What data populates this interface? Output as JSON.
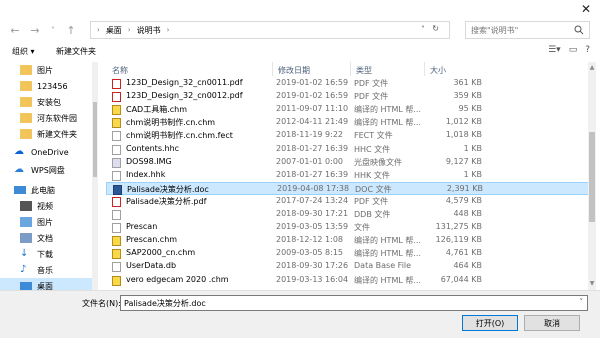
{
  "titlebar": {
    "close_glyph": "✕"
  },
  "address": {
    "segments": [
      "桌面",
      "说明书"
    ],
    "separator": "›",
    "drop_glyph": "˅",
    "refresh_glyph": "↻"
  },
  "search": {
    "placeholder": "搜索\"说明书\""
  },
  "toolbar": {
    "organize": "组织 ▾",
    "new_folder": "新建文件夹"
  },
  "nav": {
    "items": [
      {
        "label": "图片",
        "icon": "folder-icon"
      },
      {
        "label": "123456",
        "icon": "folder-icon"
      },
      {
        "label": "安装包",
        "icon": "folder-icon"
      },
      {
        "label": "河东软件园",
        "icon": "folder-icon"
      },
      {
        "label": "新建文件夹",
        "icon": "folder-icon"
      },
      {
        "label": "OneDrive",
        "icon": "cloud-icon"
      },
      {
        "label": "WPS网盘",
        "icon": "cloud-icon"
      },
      {
        "label": "此电脑",
        "icon": "computer-icon"
      },
      {
        "label": "视频",
        "icon": "video-icon"
      },
      {
        "label": "图片",
        "icon": "picture-icon"
      },
      {
        "label": "文档",
        "icon": "document-icon"
      },
      {
        "label": "下载",
        "icon": "download-icon"
      },
      {
        "label": "音乐",
        "icon": "music-icon"
      },
      {
        "label": "桌面",
        "icon": "desktop-icon"
      }
    ]
  },
  "columns": {
    "name": "名称",
    "date": "修改日期",
    "type": "类型",
    "size": "大小"
  },
  "files": [
    {
      "name": "123D_Design_32_cn0011.pdf",
      "date": "2019-01-02 16:59",
      "type": "PDF 文件",
      "size": "361 KB",
      "kind": "pdf"
    },
    {
      "name": "123D_Design_32_cn0012.pdf",
      "date": "2019-01-02 16:59",
      "type": "PDF 文件",
      "size": "359 KB",
      "kind": "pdf"
    },
    {
      "name": "CAD工具箱.chm",
      "date": "2011-09-07 11:10",
      "type": "编译的 HTML 帮...",
      "size": "95 KB",
      "kind": "chm"
    },
    {
      "name": "chm说明书制作.cn.chm",
      "date": "2012-04-11 21:49",
      "type": "编译的 HTML 帮...",
      "size": "1,012 KB",
      "kind": "chm"
    },
    {
      "name": "chm说明书制作.cn.chm.fect",
      "date": "2018-11-19 9:22",
      "type": "FECT 文件",
      "size": "1,018 KB",
      "kind": "blank"
    },
    {
      "name": "Contents.hhc",
      "date": "2018-01-27 16:39",
      "type": "HHC 文件",
      "size": "1 KB",
      "kind": "blank"
    },
    {
      "name": "DOS98.IMG",
      "date": "2007-01-01 0:00",
      "type": "光盘映像文件",
      "size": "9,127 KB",
      "kind": "img"
    },
    {
      "name": "Index.hhk",
      "date": "2018-01-27 16:39",
      "type": "HHK 文件",
      "size": "1 KB",
      "kind": "blank"
    },
    {
      "name": "Palisade决策分析.doc",
      "date": "2019-04-08 17:38",
      "type": "DOC 文件",
      "size": "2,391 KB",
      "kind": "doc",
      "selected": true
    },
    {
      "name": "Palisade决策分析.pdf",
      "date": "2017-07-24 13:24",
      "type": "PDF 文件",
      "size": "4,579 KB",
      "kind": "pdf"
    },
    {
      "name": "",
      "date": "2018-09-30 17:21",
      "type": "DDB 文件",
      "size": "448 KB",
      "kind": "blank"
    },
    {
      "name": "Prescan",
      "date": "2019-03-05 13:59",
      "type": "文件",
      "size": "131,275 KB",
      "kind": "blank"
    },
    {
      "name": "Prescan.chm",
      "date": "2018-12-12 1:08",
      "type": "编译的 HTML 帮...",
      "size": "126,119 KB",
      "kind": "chm"
    },
    {
      "name": "SAP2000_cn.chm",
      "date": "2009-03-05 8:15",
      "type": "编译的 HTML 帮...",
      "size": "4,761 KB",
      "kind": "chm"
    },
    {
      "name": "UserData.db",
      "date": "2018-09-30 17:26",
      "type": "Data Base File",
      "size": "464 KB",
      "kind": "blank"
    },
    {
      "name": "vero edgecam 2020 .chm",
      "date": "2019-03-13 16:04",
      "type": "编译的 HTML 帮...",
      "size": "67,044 KB",
      "kind": "chm"
    }
  ],
  "filename": {
    "label": "文件名(N):",
    "value": "Palisade决策分析.doc"
  },
  "buttons": {
    "open": "打开(O)",
    "cancel": "取消"
  }
}
